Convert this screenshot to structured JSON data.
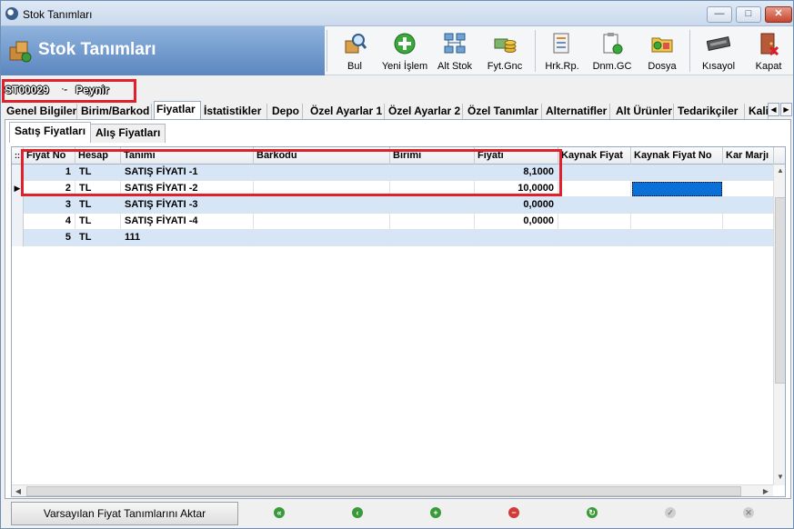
{
  "window": {
    "title": "Stok Tanımları"
  },
  "header": {
    "title": "Stok Tanımları"
  },
  "toolbar": [
    {
      "label": "Bul",
      "icon": "search-box-icon"
    },
    {
      "label": "Yeni İşlem",
      "icon": "add-icon"
    },
    {
      "label": "Alt Stok",
      "icon": "network-icon"
    },
    {
      "label": "Fyt.Gnc",
      "icon": "money-icon"
    },
    {
      "label": "Hrk.Rp.",
      "icon": "report-icon"
    },
    {
      "label": "Dnm.GC",
      "icon": "clipboard-icon"
    },
    {
      "label": "Dosya",
      "icon": "folder-icon"
    },
    {
      "label": "Kısayol",
      "icon": "keyboard-icon"
    },
    {
      "label": "Kapat",
      "icon": "exit-door-icon"
    }
  ],
  "record": {
    "code": "ST00029",
    "separator": "-",
    "name": "Peynir"
  },
  "main_tabs": [
    "Genel Bilgiler",
    "Birim/Barkod",
    "Fiyatlar",
    "İstatistikler",
    "Depo",
    "Özel Ayarlar 1",
    "Özel Ayarlar 2",
    "Özel Tanımlar",
    "Alternatifler",
    "Alt Ürünler",
    "Tedarikçiler",
    "Kali"
  ],
  "active_main_tab": "Fiyatlar",
  "sub_tabs": [
    "Satış Fiyatları",
    "Alış Fiyatları"
  ],
  "active_sub_tab": "Satış Fiyatları",
  "grid": {
    "columns": [
      "Fiyat No",
      "Hesap",
      "Tanımı",
      "Barkodu",
      "Birimi",
      "Fiyatı",
      "Kaynak Fiyat",
      "Kaynak Fiyat No",
      "Kar Marjı"
    ],
    "rows": [
      {
        "fiyat_no": "1",
        "hesap": "TL",
        "tanimi": "SATIŞ FİYATI -1",
        "barkodu": "",
        "birimi": "",
        "fiyati": "8,1000"
      },
      {
        "fiyat_no": "2",
        "hesap": "TL",
        "tanimi": "SATIŞ FİYATI -2",
        "barkodu": "",
        "birimi": "",
        "fiyati": "10,0000"
      },
      {
        "fiyat_no": "3",
        "hesap": "TL",
        "tanimi": "SATIŞ FİYATI -3",
        "barkodu": "",
        "birimi": "",
        "fiyati": "0,0000"
      },
      {
        "fiyat_no": "4",
        "hesap": "TL",
        "tanimi": "SATIŞ FİYATI -4",
        "barkodu": "",
        "birimi": "",
        "fiyati": "0,0000"
      },
      {
        "fiyat_no": "5",
        "hesap": "TL",
        "tanimi": "111",
        "barkodu": "",
        "birimi": "",
        "fiyati": ""
      }
    ],
    "current_row_indicator": "▶",
    "header_corner": "::"
  },
  "bottom": {
    "default_button": "Varsayılan Fiyat Tanımlarını Aktar"
  },
  "colors": {
    "highlight_red": "#e0202a",
    "row_alt": "#d7e6f7",
    "selected_cell": "#0a6fd6"
  }
}
